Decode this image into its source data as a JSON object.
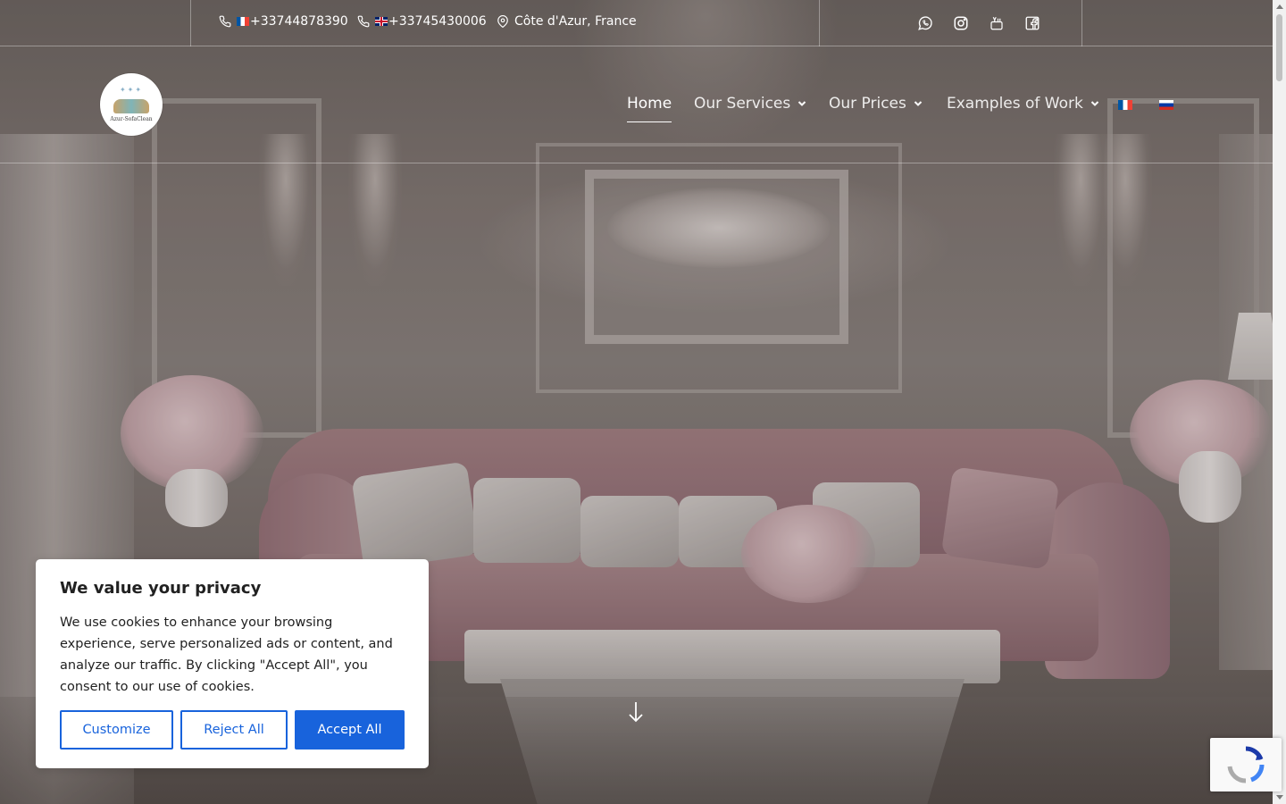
{
  "topbar": {
    "phones": [
      {
        "flag": "fr",
        "number": "+33744878390"
      },
      {
        "flag": "gb",
        "number": "+33745430006"
      }
    ],
    "location": "Côte d'Azur, France",
    "social_icons": [
      "whatsapp-icon",
      "instagram-icon",
      "youtube-icon",
      "facebook-icon"
    ]
  },
  "header": {
    "logo_text": "Azur-SofaClean",
    "nav": {
      "home": "Home",
      "services": "Our Services",
      "prices": "Our Prices",
      "examples": "Examples of Work"
    },
    "languages": [
      "fr",
      "ru"
    ]
  },
  "cookie": {
    "title": "We value your privacy",
    "body": "We use cookies to enhance your browsing experience, serve personalized ads or content, and analyze our traffic. By clicking \"Accept All\", you consent to our use of cookies.",
    "customize": "Customize",
    "reject": "Reject All",
    "accept": "Accept All"
  },
  "colors": {
    "accent": "#1863dc",
    "text_dark": "#212121"
  }
}
